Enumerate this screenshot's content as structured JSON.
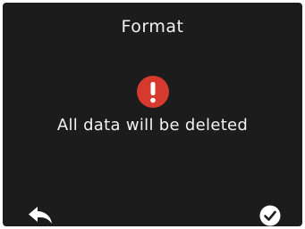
{
  "dialog": {
    "title": "Format",
    "message": "All data will be deleted",
    "alert_icon": "exclamation-icon",
    "alert_color": "#d63a2e"
  },
  "actions": {
    "back_icon": "back-arrow-icon",
    "confirm_icon": "checkmark-circle-icon"
  }
}
